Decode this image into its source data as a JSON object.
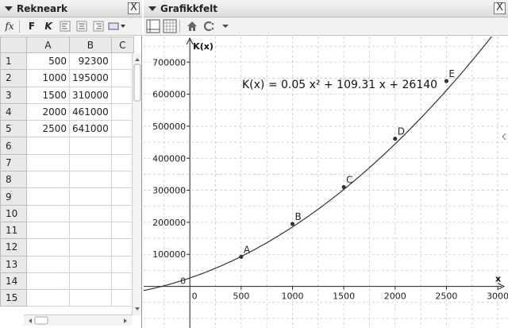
{
  "spreadsheet": {
    "title": "Rekneark",
    "close_label": "X",
    "toolbar": {
      "fx_label": "fx",
      "bold_label": "F",
      "italic_label": "K"
    },
    "columns": [
      "A",
      "B",
      "C"
    ],
    "row_numbers": [
      "1",
      "2",
      "3",
      "4",
      "5",
      "6",
      "7",
      "8",
      "9",
      "10",
      "11",
      "12",
      "13",
      "14",
      "15"
    ],
    "rows": [
      [
        "500",
        "92300"
      ],
      [
        "1000",
        "195000"
      ],
      [
        "1500",
        "310000"
      ],
      [
        "2000",
        "461000"
      ],
      [
        "2500",
        "641000"
      ]
    ]
  },
  "graphics": {
    "title": "Grafikkfelt",
    "close_label": "X",
    "equation": "K(x)  =  0.05 x² + 109.31 x + 26140",
    "colors": {
      "curve": "#333333",
      "grid": "#c8c8c8",
      "axis": "#222222",
      "point": "#333333"
    },
    "chart_data": {
      "type": "scatter",
      "ylabel": "K(x)",
      "xlabel": "x",
      "x_ticks": [
        "0",
        "500",
        "1000",
        "1500",
        "2000",
        "2500",
        "3000"
      ],
      "y_ticks": [
        "0",
        "100000",
        "200000",
        "300000",
        "400000",
        "500000",
        "600000",
        "700000"
      ],
      "xlim": [
        -450,
        3100
      ],
      "ylim": [
        -130000,
        780000
      ],
      "grid": true,
      "function": {
        "a": 0.05,
        "b": 109.31,
        "c": 26140
      },
      "points": [
        {
          "label": "A",
          "x": 500,
          "y": 92300
        },
        {
          "label": "B",
          "x": 1000,
          "y": 195000
        },
        {
          "label": "C",
          "x": 1500,
          "y": 310000
        },
        {
          "label": "D",
          "x": 2000,
          "y": 461000
        },
        {
          "label": "E",
          "x": 2500,
          "y": 641000
        }
      ]
    }
  }
}
